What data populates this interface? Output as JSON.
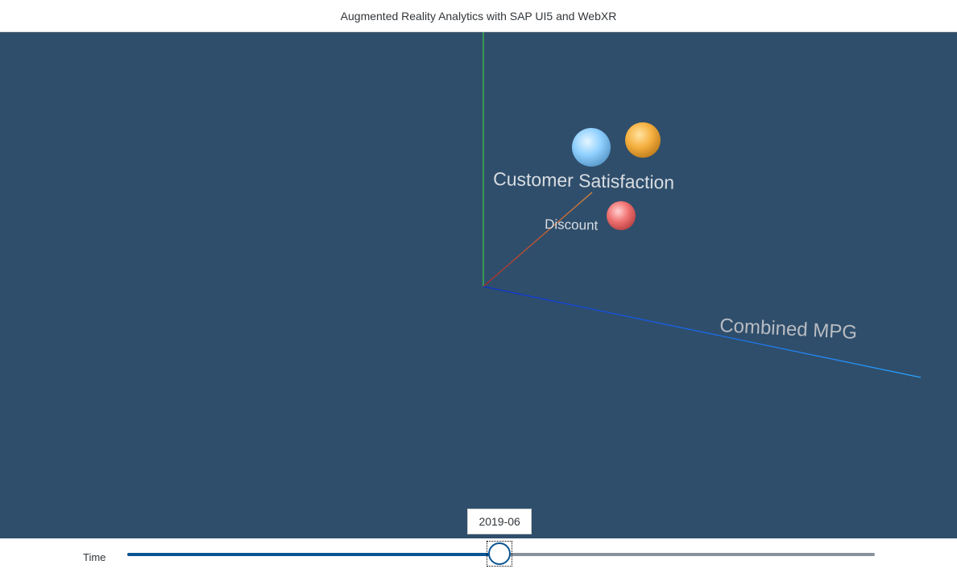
{
  "header": {
    "title": "Augmented Reality Analytics with SAP UI5 and WebXR"
  },
  "scene": {
    "axes": {
      "y_color": "#3fe03f",
      "x_color": "#c0392b",
      "z_color_start": "#0b2fd0",
      "z_color_end": "#2aa3ff"
    },
    "labels": {
      "customer_satisfaction": "Customer Satisfaction",
      "discount": "Discount",
      "combined_mpg": "Combined MPG"
    },
    "spheres": [
      {
        "name": "blue-sphere",
        "color": "#9fd8ff"
      },
      {
        "name": "orange-sphere",
        "color": "#f5b54a"
      },
      {
        "name": "red-sphere",
        "color": "#f07a7a"
      }
    ]
  },
  "time_slider": {
    "label": "Time",
    "value": "2019-06",
    "progress": 0.498
  }
}
